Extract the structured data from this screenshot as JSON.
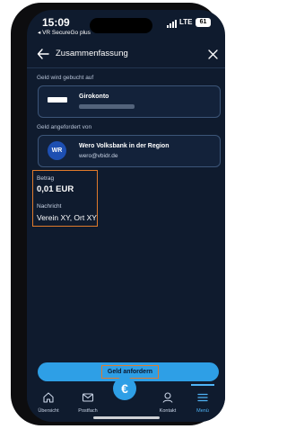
{
  "status": {
    "time": "15:09",
    "carrier": "◂ VR SecureGo plus",
    "network": "LTE",
    "battery": "61"
  },
  "header": {
    "title": "Zusammenfassung"
  },
  "booking": {
    "label": "Geld wird gebucht auf",
    "account_name": "Girokonto"
  },
  "requested": {
    "label": "Geld angefordert von",
    "logo_text": "WR",
    "name": "Wero Volksbank in der Region",
    "email": "wero@vbidr.de"
  },
  "details": {
    "amount_label": "Betrag",
    "amount": "0,01 EUR",
    "message_label": "Nachricht",
    "message": "Verein XY, Ort XY"
  },
  "cta": {
    "label": "Geld anfordern"
  },
  "nav": {
    "items": [
      {
        "label": "Übersicht",
        "icon": "home-icon"
      },
      {
        "label": "Postfach",
        "icon": "mail-icon"
      },
      {
        "label": "",
        "icon": "euro-icon",
        "symbol": "€"
      },
      {
        "label": "Kontakt",
        "icon": "contact-icon"
      },
      {
        "label": "Menü",
        "icon": "menu-icon"
      }
    ]
  },
  "colors": {
    "background": "#0f1b2e",
    "accent": "#2e9fe6",
    "highlight": "#e07a2b"
  }
}
